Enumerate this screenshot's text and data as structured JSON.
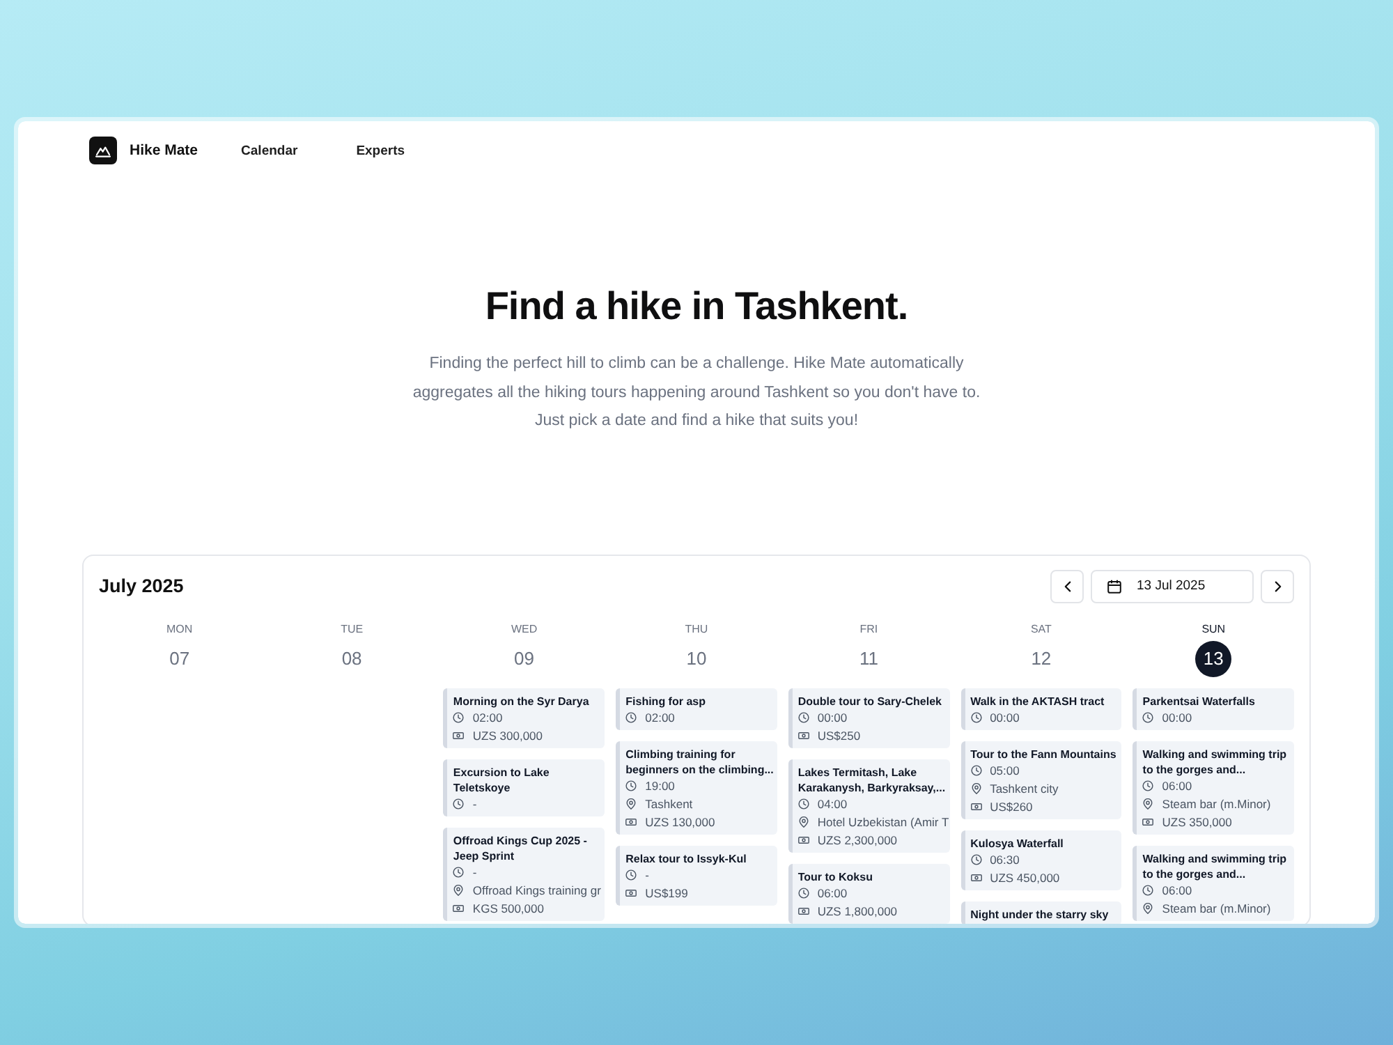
{
  "header": {
    "brand": "Hike Mate",
    "nav": [
      {
        "label": "Calendar"
      },
      {
        "label": "Experts"
      }
    ]
  },
  "hero": {
    "title": "Find a hike in Tashkent.",
    "text": "Finding the perfect hill to climb can be a challenge. Hike Mate automatically aggregates all the hiking tours happening around Tashkent so you don't have to. Just pick a date and find a hike that suits you!"
  },
  "calendar": {
    "month": "July 2025",
    "date_field": {
      "value": "13 Jul 2025"
    },
    "days": [
      {
        "weekday": "MON",
        "date": "07",
        "selected": false
      },
      {
        "weekday": "TUE",
        "date": "08",
        "selected": false
      },
      {
        "weekday": "WED",
        "date": "09",
        "selected": false,
        "events": [
          {
            "title": "Morning on the Syr Darya",
            "details": [
              {
                "kind": "time",
                "text": "02:00"
              },
              {
                "kind": "price",
                "text": "UZS 300,000"
              }
            ]
          },
          {
            "title": "Excursion to Lake Teletskoye",
            "details": [
              {
                "kind": "time",
                "text": "-"
              }
            ]
          },
          {
            "title": "Offroad Kings Cup 2025 - Jeep Sprint",
            "details": [
              {
                "kind": "time",
                "text": "-"
              },
              {
                "kind": "location",
                "text": "Offroad Kings training gr"
              },
              {
                "kind": "price",
                "text": "KGS 500,000"
              }
            ]
          }
        ]
      },
      {
        "weekday": "THU",
        "date": "10",
        "selected": false,
        "events": [
          {
            "title": "Fishing for asp",
            "details": [
              {
                "kind": "time",
                "text": "02:00"
              }
            ]
          },
          {
            "title": "Climbing training for beginners on the climbing...",
            "details": [
              {
                "kind": "time",
                "text": "19:00"
              },
              {
                "kind": "location",
                "text": "Tashkent"
              },
              {
                "kind": "price",
                "text": "UZS 130,000"
              }
            ]
          },
          {
            "title": "Relax tour to Issyk-Kul",
            "details": [
              {
                "kind": "time",
                "text": "-"
              },
              {
                "kind": "price",
                "text": "US$199"
              }
            ]
          }
        ]
      },
      {
        "weekday": "FRI",
        "date": "11",
        "selected": false,
        "events": [
          {
            "title": "Double tour to Sary-Chelek",
            "details": [
              {
                "kind": "time",
                "text": "00:00"
              },
              {
                "kind": "price",
                "text": "US$250"
              }
            ]
          },
          {
            "title": "Lakes Termitash, Lake Karakanysh, Barkyraksay,...",
            "details": [
              {
                "kind": "time",
                "text": "04:00"
              },
              {
                "kind": "location",
                "text": "Hotel Uzbekistan (Amir T"
              },
              {
                "kind": "price",
                "text": "UZS 2,300,000"
              }
            ]
          },
          {
            "title": "Tour to Koksu",
            "details": [
              {
                "kind": "time",
                "text": "06:00"
              },
              {
                "kind": "price",
                "text": "UZS 1,800,000"
              }
            ]
          }
        ]
      },
      {
        "weekday": "SAT",
        "date": "12",
        "selected": false,
        "events": [
          {
            "title": "Walk in the AKTASH tract",
            "details": [
              {
                "kind": "time",
                "text": "00:00"
              }
            ]
          },
          {
            "title": "Tour to the Fann Mountains",
            "details": [
              {
                "kind": "time",
                "text": "05:00"
              },
              {
                "kind": "location",
                "text": "Tashkent city"
              },
              {
                "kind": "price",
                "text": "US$260"
              }
            ]
          },
          {
            "title": "Kulosya Waterfall",
            "details": [
              {
                "kind": "time",
                "text": "06:30"
              },
              {
                "kind": "price",
                "text": "UZS 450,000"
              }
            ]
          },
          {
            "title": "Night under the starry sky"
          }
        ]
      },
      {
        "weekday": "SUN",
        "date": "13",
        "selected": true,
        "events": [
          {
            "title": "Parkentsai Waterfalls",
            "details": [
              {
                "kind": "time",
                "text": "00:00"
              }
            ]
          },
          {
            "title": "Walking and swimming trip to the gorges and...",
            "details": [
              {
                "kind": "time",
                "text": "06:00"
              },
              {
                "kind": "location",
                "text": "Steam bar (m.Minor)"
              },
              {
                "kind": "price",
                "text": "UZS 350,000"
              }
            ]
          },
          {
            "title": "Walking and swimming trip to the gorges and...",
            "details": [
              {
                "kind": "time",
                "text": "06:00"
              },
              {
                "kind": "location",
                "text": "Steam bar (m.Minor)"
              }
            ]
          }
        ]
      }
    ]
  }
}
